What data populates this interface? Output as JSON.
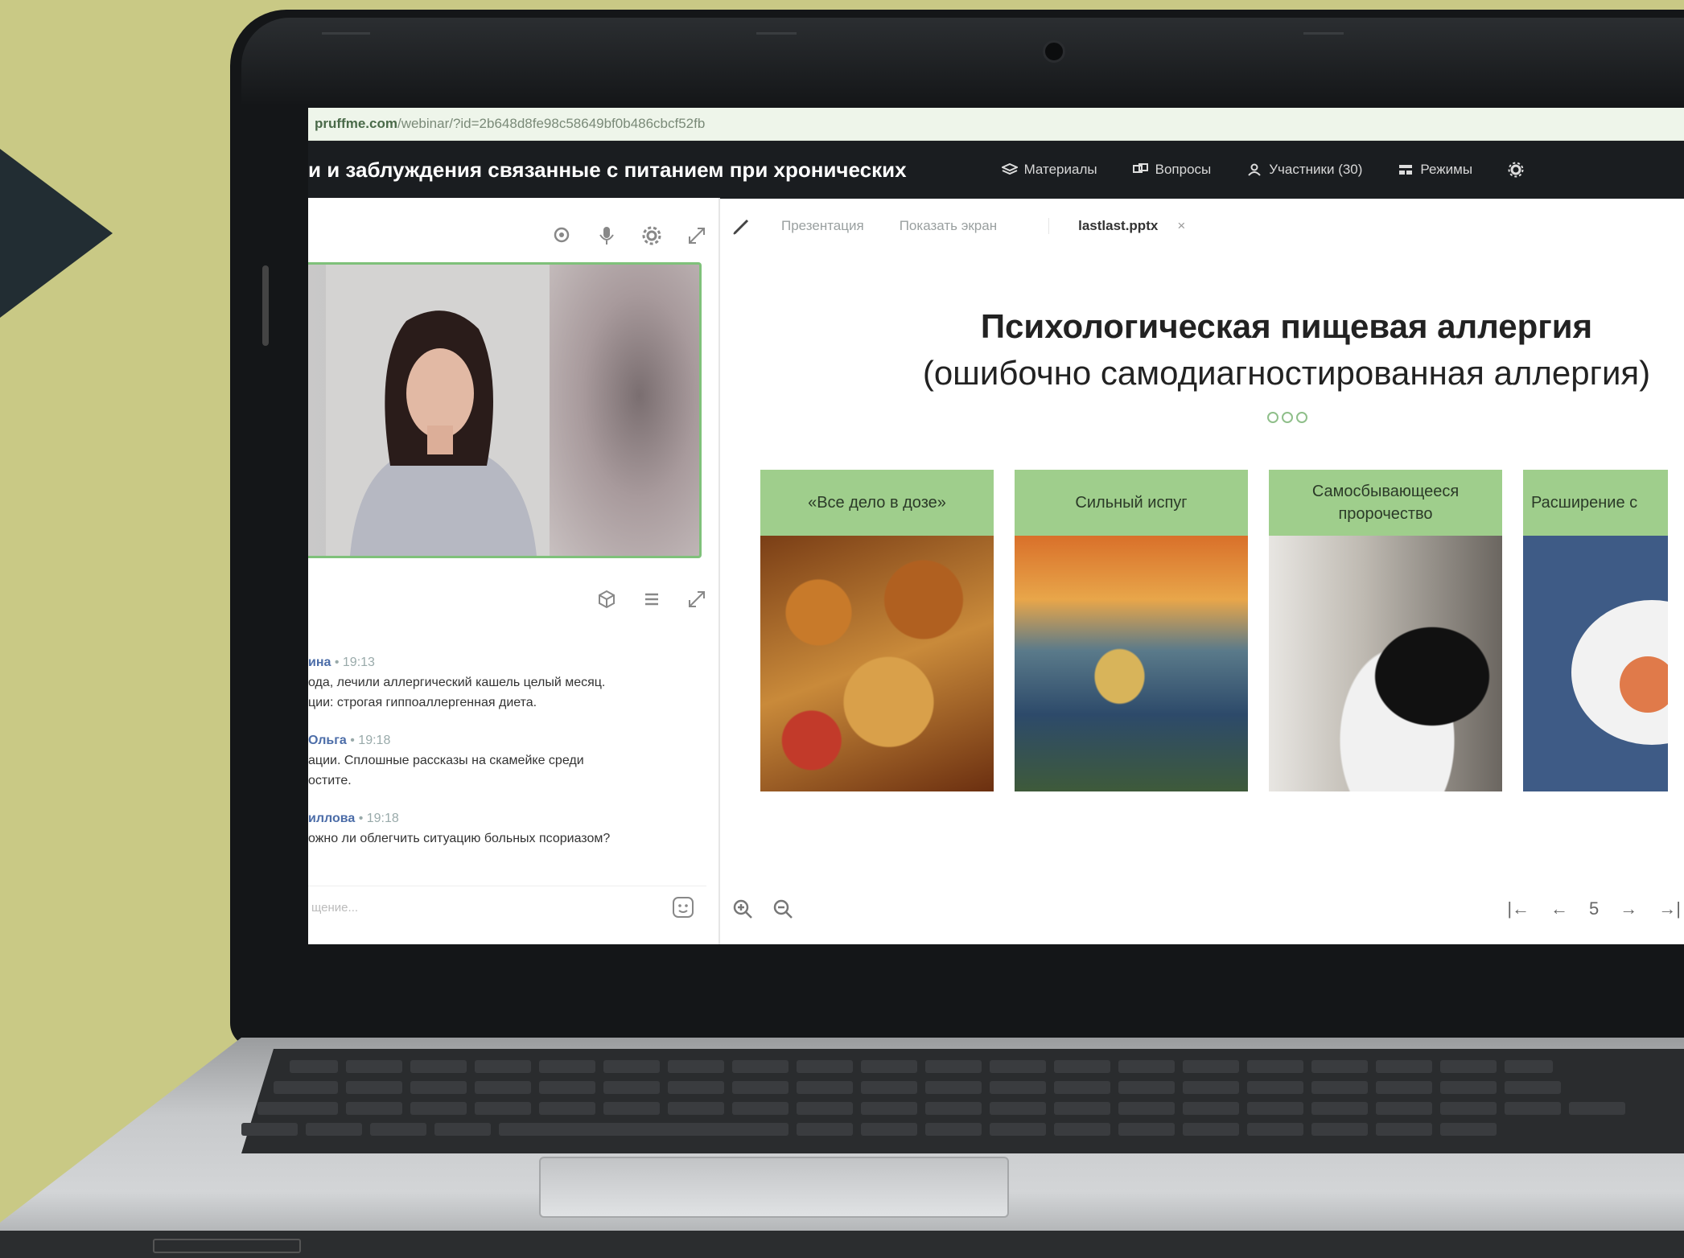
{
  "browser": {
    "url_host": "pruffme.com",
    "url_path": "/webinar/?id=2b648d8fe98c58649bf0b486cbcf52fb"
  },
  "header": {
    "title": "и и заблуждения связанные с питанием при хронических",
    "nav": [
      {
        "label": "Материалы",
        "icon": "layers-icon"
      },
      {
        "label": "Вопросы",
        "icon": "questions-icon"
      },
      {
        "label": "Участники (30)",
        "icon": "user-icon"
      },
      {
        "label": "Режимы",
        "icon": "modes-icon"
      }
    ]
  },
  "chat": {
    "messages": [
      {
        "author": "ина",
        "time": "• 19:13",
        "lines": [
          "ода, лечили аллергический кашель целый месяц.",
          "ции: строгая гиппоаллергенная диета."
        ]
      },
      {
        "author": "Ольга",
        "time": "• 19:18",
        "lines": [
          "ации. Сплошные рассказы на скамейке среди",
          "остите."
        ]
      },
      {
        "author": "иллова",
        "time": "• 19:18",
        "lines": [
          "ожно ли облегчить ситуацию больных псориазом?"
        ]
      }
    ],
    "input_placeholder": "щение..."
  },
  "presentation": {
    "tabs": [
      "Презентация",
      "Показать экран"
    ],
    "file_name": "lastlast.pptx",
    "close_label": "×",
    "slide_title": "Психологическая пищевая аллергия",
    "slide_subtitle": "(ошибочно самодиагностированная аллергия)",
    "cards": [
      {
        "label": "«Все дело в дозе»"
      },
      {
        "label": "Сильный испуг"
      },
      {
        "label": "Самосбывающееся пророчество"
      },
      {
        "label": "Расширение с"
      }
    ],
    "pager": {
      "first": "|←",
      "prev": "←",
      "page": "5",
      "next": "→",
      "last": "→|"
    }
  },
  "colors": {
    "background": "#c9c985",
    "accent_green": "#9fce8c",
    "topbar": "#1a1d20",
    "chevron": "#222d33"
  }
}
